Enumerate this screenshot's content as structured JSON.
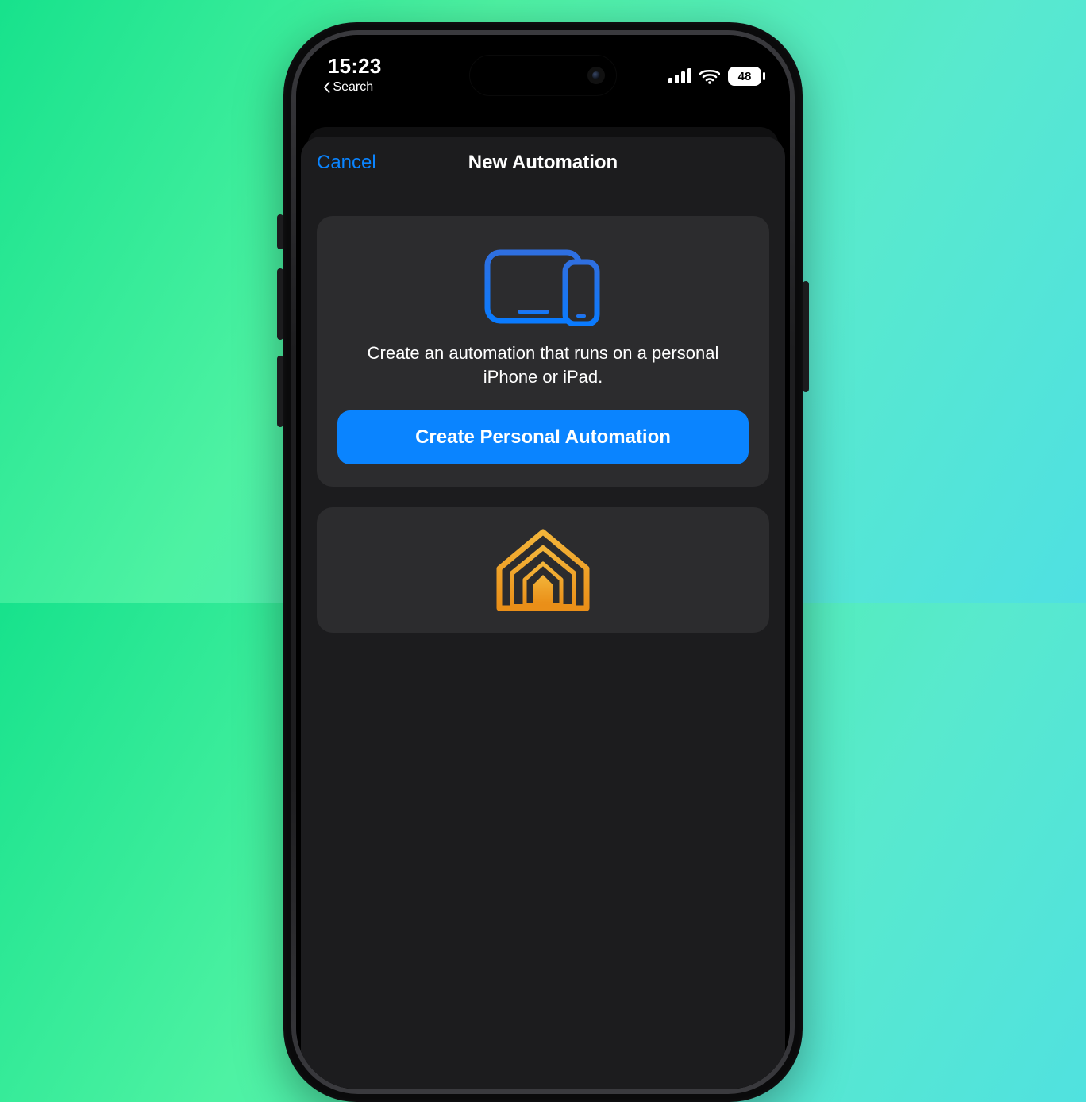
{
  "status": {
    "time": "15:23",
    "breadcrumb": "Search",
    "battery": "48"
  },
  "sheet": {
    "cancel_label": "Cancel",
    "title": "New Automation"
  },
  "personal": {
    "description": "Create an automation that runs on a personal iPhone or iPad.",
    "button": "Create Personal Automation"
  },
  "colors": {
    "accent_blue": "#0a84ff",
    "icon_blue_a": "#2f6fe0",
    "icon_blue_b": "#0a7bff",
    "home_orange": "#f0a020"
  }
}
